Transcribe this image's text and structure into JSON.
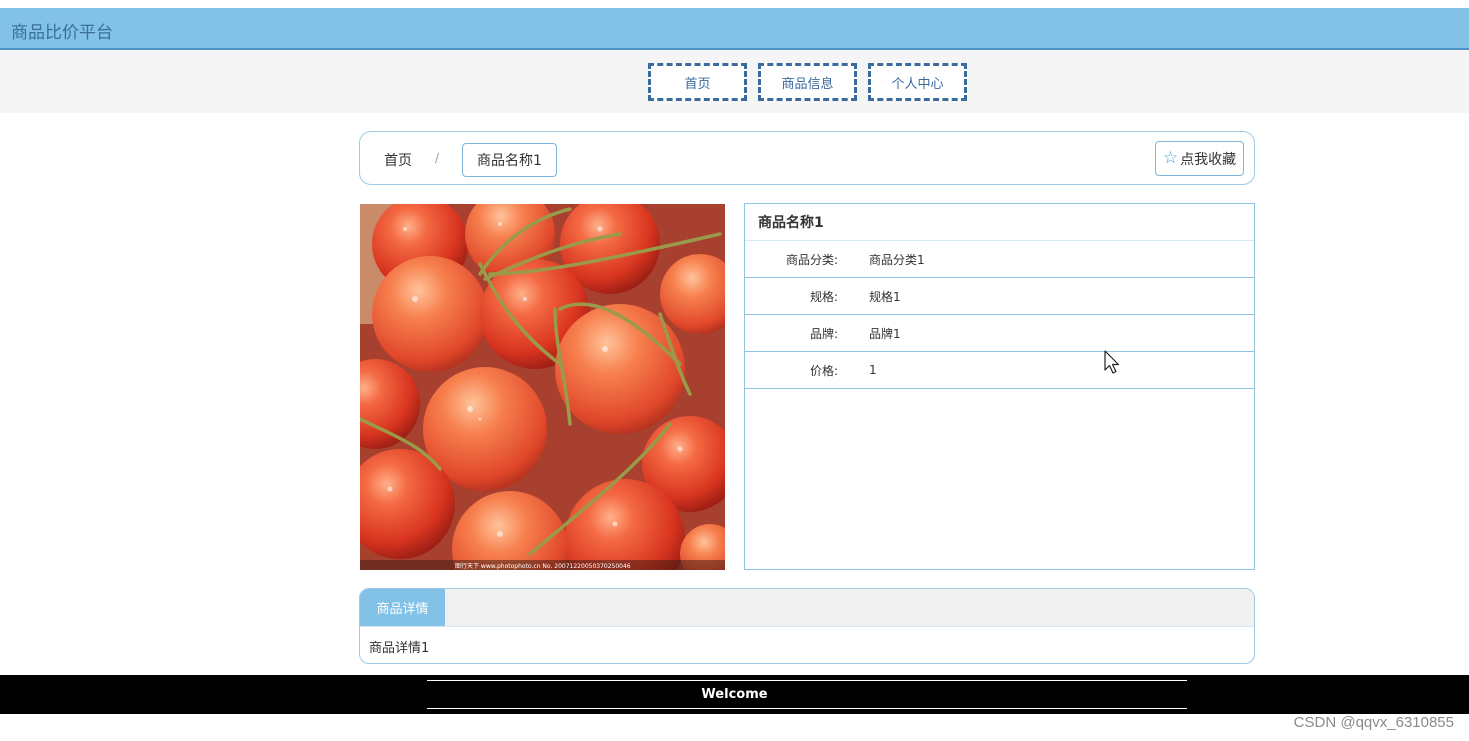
{
  "app": {
    "title": "商品比价平台"
  },
  "nav": {
    "items": [
      "首页",
      "商品信息",
      "个人中心"
    ]
  },
  "breadcrumb": {
    "home": "首页",
    "separator": "/",
    "current": "商品名称1"
  },
  "favorite": {
    "label": "点我收藏",
    "icon": "star-outline-icon"
  },
  "product": {
    "image_icon": "cherries-photo",
    "image_caption": "图行天下 www.photophoto.cn No. 20071220050370250046",
    "name": "商品名称1",
    "rows": [
      {
        "label": "商品分类:",
        "value": "商品分类1"
      },
      {
        "label": "规格:",
        "value": "规格1"
      },
      {
        "label": "品牌:",
        "value": "品牌1"
      },
      {
        "label": "价格:",
        "value": "1"
      }
    ]
  },
  "detail": {
    "tab": "商品详情",
    "content": "商品详情1"
  },
  "footer": {
    "text": "Welcome"
  },
  "watermark": "CSDN @qqvx_6310855",
  "colors": {
    "header": "#82c2e6",
    "nav_border": "#3a6a9e",
    "panel_border": "#9ccbe6",
    "footer": "#000000"
  }
}
